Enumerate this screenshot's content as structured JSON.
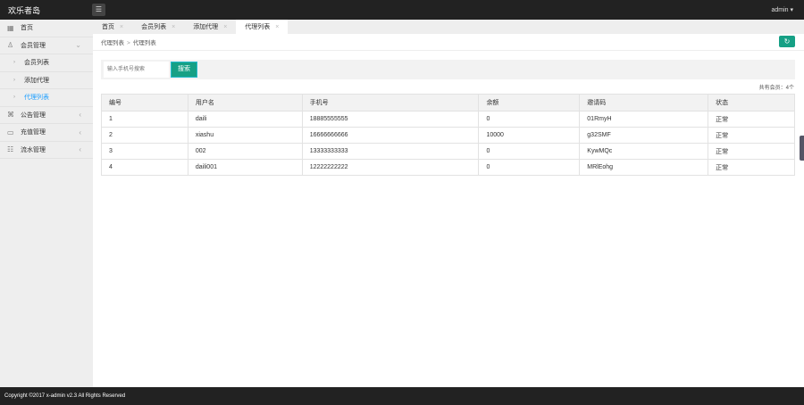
{
  "header": {
    "title": "欢乐者岛",
    "user": "admin"
  },
  "sidebar": {
    "items": [
      {
        "label": "首页",
        "icon": "grid-icon"
      },
      {
        "label": "会员管理",
        "icon": "user-icon",
        "expanded": true
      },
      {
        "label": "会员列表",
        "sub": true
      },
      {
        "label": "添加代理",
        "sub": true
      },
      {
        "label": "代理列表",
        "sub": true,
        "active": true
      },
      {
        "label": "公告管理",
        "icon": "grid-icon"
      },
      {
        "label": "充值管理",
        "icon": "card-icon"
      },
      {
        "label": "流水管理",
        "icon": "list-icon"
      }
    ]
  },
  "tabs": [
    "首页",
    "会员列表",
    "添加代理",
    "代理列表"
  ],
  "breadcrumb": [
    "代理列表",
    "代理列表"
  ],
  "search": {
    "placeholder": "输入手机号搜索",
    "button": "搜索"
  },
  "count_text": "共有会员：4个",
  "table": {
    "headers": [
      "编号",
      "用户名",
      "手机号",
      "余额",
      "邀请码",
      "状态"
    ],
    "rows": [
      [
        "1",
        "daili",
        "18885555555",
        "0",
        "01RmyH",
        "正常"
      ],
      [
        "2",
        "xiashu",
        "16666666666",
        "10000",
        "g32SMF",
        "正常"
      ],
      [
        "3",
        "002",
        "13333333333",
        "0",
        "KywMQc",
        "正常"
      ],
      [
        "4",
        "daili001",
        "12222222222",
        "0",
        "MRlEohg",
        "正常"
      ]
    ]
  },
  "footer": "Copyright ©2017 x-admin v2.3 All Rights Reserved",
  "colors": {
    "accent": "#16a085",
    "active_link": "#1e9fff",
    "topbar": "#222222"
  }
}
